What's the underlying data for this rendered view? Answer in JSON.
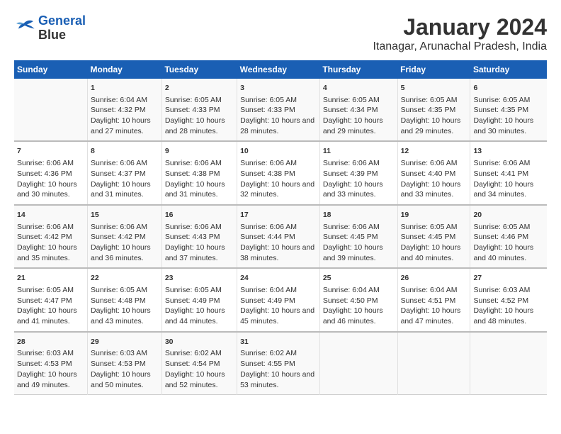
{
  "header": {
    "logo_line1": "General",
    "logo_line2": "Blue",
    "title": "January 2024",
    "subtitle": "Itanagar, Arunachal Pradesh, India"
  },
  "columns": [
    "Sunday",
    "Monday",
    "Tuesday",
    "Wednesday",
    "Thursday",
    "Friday",
    "Saturday"
  ],
  "weeks": [
    {
      "days": [
        {
          "num": "",
          "sunrise": "",
          "sunset": "",
          "daylight": ""
        },
        {
          "num": "1",
          "sunrise": "Sunrise: 6:04 AM",
          "sunset": "Sunset: 4:32 PM",
          "daylight": "Daylight: 10 hours and 27 minutes."
        },
        {
          "num": "2",
          "sunrise": "Sunrise: 6:05 AM",
          "sunset": "Sunset: 4:33 PM",
          "daylight": "Daylight: 10 hours and 28 minutes."
        },
        {
          "num": "3",
          "sunrise": "Sunrise: 6:05 AM",
          "sunset": "Sunset: 4:33 PM",
          "daylight": "Daylight: 10 hours and 28 minutes."
        },
        {
          "num": "4",
          "sunrise": "Sunrise: 6:05 AM",
          "sunset": "Sunset: 4:34 PM",
          "daylight": "Daylight: 10 hours and 29 minutes."
        },
        {
          "num": "5",
          "sunrise": "Sunrise: 6:05 AM",
          "sunset": "Sunset: 4:35 PM",
          "daylight": "Daylight: 10 hours and 29 minutes."
        },
        {
          "num": "6",
          "sunrise": "Sunrise: 6:05 AM",
          "sunset": "Sunset: 4:35 PM",
          "daylight": "Daylight: 10 hours and 30 minutes."
        }
      ]
    },
    {
      "days": [
        {
          "num": "7",
          "sunrise": "Sunrise: 6:06 AM",
          "sunset": "Sunset: 4:36 PM",
          "daylight": "Daylight: 10 hours and 30 minutes."
        },
        {
          "num": "8",
          "sunrise": "Sunrise: 6:06 AM",
          "sunset": "Sunset: 4:37 PM",
          "daylight": "Daylight: 10 hours and 31 minutes."
        },
        {
          "num": "9",
          "sunrise": "Sunrise: 6:06 AM",
          "sunset": "Sunset: 4:38 PM",
          "daylight": "Daylight: 10 hours and 31 minutes."
        },
        {
          "num": "10",
          "sunrise": "Sunrise: 6:06 AM",
          "sunset": "Sunset: 4:38 PM",
          "daylight": "Daylight: 10 hours and 32 minutes."
        },
        {
          "num": "11",
          "sunrise": "Sunrise: 6:06 AM",
          "sunset": "Sunset: 4:39 PM",
          "daylight": "Daylight: 10 hours and 33 minutes."
        },
        {
          "num": "12",
          "sunrise": "Sunrise: 6:06 AM",
          "sunset": "Sunset: 4:40 PM",
          "daylight": "Daylight: 10 hours and 33 minutes."
        },
        {
          "num": "13",
          "sunrise": "Sunrise: 6:06 AM",
          "sunset": "Sunset: 4:41 PM",
          "daylight": "Daylight: 10 hours and 34 minutes."
        }
      ]
    },
    {
      "days": [
        {
          "num": "14",
          "sunrise": "Sunrise: 6:06 AM",
          "sunset": "Sunset: 4:42 PM",
          "daylight": "Daylight: 10 hours and 35 minutes."
        },
        {
          "num": "15",
          "sunrise": "Sunrise: 6:06 AM",
          "sunset": "Sunset: 4:42 PM",
          "daylight": "Daylight: 10 hours and 36 minutes."
        },
        {
          "num": "16",
          "sunrise": "Sunrise: 6:06 AM",
          "sunset": "Sunset: 4:43 PM",
          "daylight": "Daylight: 10 hours and 37 minutes."
        },
        {
          "num": "17",
          "sunrise": "Sunrise: 6:06 AM",
          "sunset": "Sunset: 4:44 PM",
          "daylight": "Daylight: 10 hours and 38 minutes."
        },
        {
          "num": "18",
          "sunrise": "Sunrise: 6:06 AM",
          "sunset": "Sunset: 4:45 PM",
          "daylight": "Daylight: 10 hours and 39 minutes."
        },
        {
          "num": "19",
          "sunrise": "Sunrise: 6:05 AM",
          "sunset": "Sunset: 4:45 PM",
          "daylight": "Daylight: 10 hours and 40 minutes."
        },
        {
          "num": "20",
          "sunrise": "Sunrise: 6:05 AM",
          "sunset": "Sunset: 4:46 PM",
          "daylight": "Daylight: 10 hours and 40 minutes."
        }
      ]
    },
    {
      "days": [
        {
          "num": "21",
          "sunrise": "Sunrise: 6:05 AM",
          "sunset": "Sunset: 4:47 PM",
          "daylight": "Daylight: 10 hours and 41 minutes."
        },
        {
          "num": "22",
          "sunrise": "Sunrise: 6:05 AM",
          "sunset": "Sunset: 4:48 PM",
          "daylight": "Daylight: 10 hours and 43 minutes."
        },
        {
          "num": "23",
          "sunrise": "Sunrise: 6:05 AM",
          "sunset": "Sunset: 4:49 PM",
          "daylight": "Daylight: 10 hours and 44 minutes."
        },
        {
          "num": "24",
          "sunrise": "Sunrise: 6:04 AM",
          "sunset": "Sunset: 4:49 PM",
          "daylight": "Daylight: 10 hours and 45 minutes."
        },
        {
          "num": "25",
          "sunrise": "Sunrise: 6:04 AM",
          "sunset": "Sunset: 4:50 PM",
          "daylight": "Daylight: 10 hours and 46 minutes."
        },
        {
          "num": "26",
          "sunrise": "Sunrise: 6:04 AM",
          "sunset": "Sunset: 4:51 PM",
          "daylight": "Daylight: 10 hours and 47 minutes."
        },
        {
          "num": "27",
          "sunrise": "Sunrise: 6:03 AM",
          "sunset": "Sunset: 4:52 PM",
          "daylight": "Daylight: 10 hours and 48 minutes."
        }
      ]
    },
    {
      "days": [
        {
          "num": "28",
          "sunrise": "Sunrise: 6:03 AM",
          "sunset": "Sunset: 4:53 PM",
          "daylight": "Daylight: 10 hours and 49 minutes."
        },
        {
          "num": "29",
          "sunrise": "Sunrise: 6:03 AM",
          "sunset": "Sunset: 4:53 PM",
          "daylight": "Daylight: 10 hours and 50 minutes."
        },
        {
          "num": "30",
          "sunrise": "Sunrise: 6:02 AM",
          "sunset": "Sunset: 4:54 PM",
          "daylight": "Daylight: 10 hours and 52 minutes."
        },
        {
          "num": "31",
          "sunrise": "Sunrise: 6:02 AM",
          "sunset": "Sunset: 4:55 PM",
          "daylight": "Daylight: 10 hours and 53 minutes."
        },
        {
          "num": "",
          "sunrise": "",
          "sunset": "",
          "daylight": ""
        },
        {
          "num": "",
          "sunrise": "",
          "sunset": "",
          "daylight": ""
        },
        {
          "num": "",
          "sunrise": "",
          "sunset": "",
          "daylight": ""
        }
      ]
    }
  ]
}
